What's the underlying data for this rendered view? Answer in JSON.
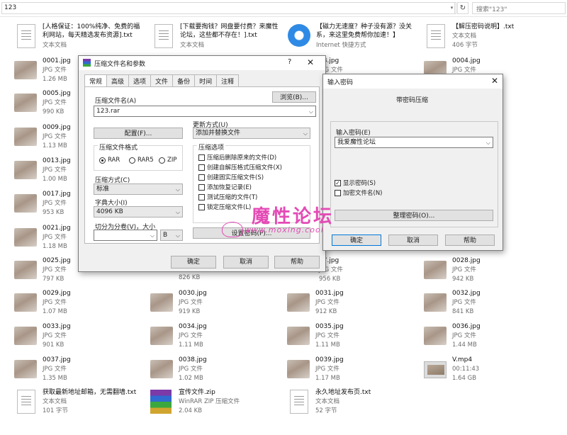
{
  "address_bar": {
    "path": "123",
    "search_placeholder": "搜索\"123\""
  },
  "top_files": [
    {
      "name": "[人格保证：100%纯净、免费的福利网站，每天精选发布资源].txt",
      "type": "文本文档",
      "size": ""
    },
    {
      "name": "[下载要掏钱？网盘要付费？来魔性论坛，这些都不存在！].txt",
      "type": "文本文档",
      "size": ""
    },
    {
      "name": "【磁力无速度？种子没有源？没关系，来这里免费帮你加速！】",
      "type": "Internet 快捷方式",
      "size": ""
    },
    {
      "name": "【解压密码说明】.txt",
      "type": "文本文档",
      "size": "406 字节"
    }
  ],
  "image_files": [
    {
      "name": "0001.jpg",
      "type": "JPG 文件",
      "size": "1.26 MB"
    },
    {
      "name": "0005.jpg",
      "type": "JPG 文件",
      "size": "990 KB"
    },
    {
      "name": "0009.jpg",
      "type": "JPG 文件",
      "size": "1.13 MB"
    },
    {
      "name": "0013.jpg",
      "type": "JPG 文件",
      "size": "1.00 MB"
    },
    {
      "name": "0017.jpg",
      "type": "JPG 文件",
      "size": "953 KB"
    },
    {
      "name": "0021.jpg",
      "type": "JPG 文件",
      "size": "1.18 MB"
    },
    {
      "name": "0025.jpg",
      "type": "JPG 文件",
      "size": "797 KB"
    },
    {
      "name": "0029.jpg",
      "type": "JPG 文件",
      "size": "1.07 MB"
    },
    {
      "name": "0033.jpg",
      "type": "JPG 文件",
      "size": "901 KB"
    },
    {
      "name": "0037.jpg",
      "type": "JPG 文件",
      "size": "1.35 MB"
    },
    {
      "name": "",
      "type": "",
      "size": "826 KB"
    },
    {
      "name": "0030.jpg",
      "type": "JPG 文件",
      "size": "919 KB"
    },
    {
      "name": "0034.jpg",
      "type": "JPG 文件",
      "size": "1.11 MB"
    },
    {
      "name": "0038.jpg",
      "type": "JPG 文件",
      "size": "1.02 MB"
    },
    {
      "name": "03.jpg",
      "type": "JPG 文件",
      "size": ""
    },
    {
      "name": "27.jpg",
      "type": "JPG 文件",
      "size": "956 KB"
    },
    {
      "name": "0031.jpg",
      "type": "JPG 文件",
      "size": "912 KB"
    },
    {
      "name": "0035.jpg",
      "type": "JPG 文件",
      "size": "1.11 MB"
    },
    {
      "name": "0039.jpg",
      "type": "JPG 文件",
      "size": "1.17 MB"
    },
    {
      "name": "0004.jpg",
      "type": "JPG 文件",
      "size": ""
    },
    {
      "name": "0028.jpg",
      "type": "JPG 文件",
      "size": "942 KB"
    },
    {
      "name": "0032.jpg",
      "type": "JPG 文件",
      "size": "841 KB"
    },
    {
      "name": "0036.jpg",
      "type": "JPG 文件",
      "size": "1.44 MB"
    },
    {
      "name": "V.mp4",
      "type": "00:11:43",
      "size": "1.64 GB"
    }
  ],
  "bottom_files": [
    {
      "name": "获取最新地址邮箱，无需翻墙.txt",
      "type": "文本文档",
      "size": "101 字节"
    },
    {
      "name": "宣传文件.zip",
      "type": "WinRAR ZIP 压缩文件",
      "size": "2.04 KB"
    },
    {
      "name": "永久地址发布页.txt",
      "type": "文本文档",
      "size": "52 字节"
    }
  ],
  "compress_dialog": {
    "title": "压缩文件名和参数",
    "tabs": [
      "常规",
      "高级",
      "选项",
      "文件",
      "备份",
      "时间",
      "注释"
    ],
    "archive_name_label": "压缩文件名(A)",
    "browse_button": "浏览(B)...",
    "archive_name": "123.rar",
    "update_mode_label": "更新方式(U)",
    "update_mode": "添加并替换文件",
    "profiles_button": "配置(F)...",
    "format_label": "压缩文件格式",
    "formats": [
      "RAR",
      "RAR5",
      "ZIP"
    ],
    "selected_format": "RAR",
    "method_label": "压缩方式(C)",
    "method": "标准",
    "dict_label": "字典大小(I)",
    "dict_size": "4096 KB",
    "split_label": "切分为分卷(V)，大小",
    "split_value": "",
    "split_unit": "B",
    "options_label": "压缩选项",
    "options": [
      {
        "label": "压缩后删除原来的文件(D)",
        "checked": false
      },
      {
        "label": "创建自解压格式压缩文件(X)",
        "checked": false
      },
      {
        "label": "创建固实压缩文件(S)",
        "checked": false
      },
      {
        "label": "添加恢复记录(E)",
        "checked": false
      },
      {
        "label": "测试压缩的文件(T)",
        "checked": false
      },
      {
        "label": "锁定压缩文件(L)",
        "checked": false
      }
    ],
    "set_password_button": "设置密码(P)...",
    "ok_button": "确定",
    "cancel_button": "取消",
    "help_button": "帮助"
  },
  "password_dialog": {
    "title": "输入密码",
    "subtitle": "带密码压缩",
    "enter_label": "输入密码(E)",
    "password_value": "我爱魔性论坛",
    "show_password_label": "显示密码(S)",
    "show_password_checked": true,
    "encrypt_names_label": "加密文件名(N)",
    "encrypt_names_checked": false,
    "organize_button": "整理密码(O)...",
    "ok_button": "确定",
    "cancel_button": "取消",
    "help_button": "帮助"
  },
  "watermark": {
    "logo": "魔性论坛",
    "url": "www.moxing.cool"
  },
  "colors": {
    "accent": "#0078d7",
    "watermark": "#e44bb5"
  }
}
